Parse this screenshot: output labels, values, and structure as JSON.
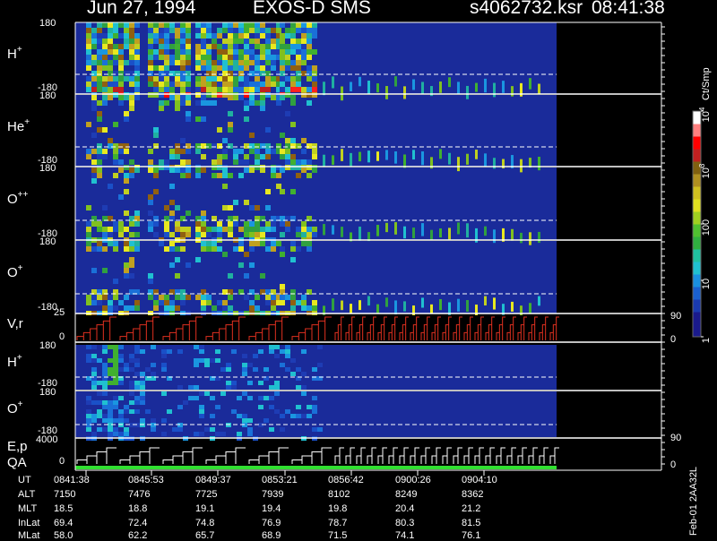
{
  "header": {
    "date": "Jun 27, 1994",
    "instrument": "EXOS-D SMS",
    "file": "s4062732.ksr",
    "time": "08:41:38"
  },
  "panels": [
    {
      "id": "H+",
      "label": "H",
      "sup": "+",
      "ytop": "180",
      "ybot": "-180"
    },
    {
      "id": "He+",
      "label": "He",
      "sup": "+",
      "ytop": "180",
      "ybot": "-180"
    },
    {
      "id": "O++",
      "label": "O",
      "sup": "++",
      "ytop": "180",
      "ybot": "-180"
    },
    {
      "id": "O+",
      "label": "O",
      "sup": "+",
      "ytop": "180",
      "ybot": "-180"
    }
  ],
  "vr_panel": {
    "label": "V,r",
    "ytop": "25",
    "ybot": "0",
    "right_top": "90",
    "right_bot": "0"
  },
  "lower_panels": [
    {
      "id": "H+2",
      "label": "H",
      "sup": "+",
      "ytop": "180",
      "ybot": "-180"
    },
    {
      "id": "O+2",
      "label": "O",
      "sup": "+",
      "ytop": "180",
      "ybot": "-180"
    }
  ],
  "ep_panel": {
    "label1": "E,p",
    "label2": "QA",
    "ytop": "4000",
    "ybot": "0",
    "right_top": "90",
    "right_bot": "0"
  },
  "colorbar": {
    "title": "Ct/Smp",
    "scale": "log",
    "range": [
      1,
      10000
    ],
    "ticks": [
      {
        "value": 10000,
        "label": "10",
        "sup": "4"
      },
      {
        "value": 1000,
        "label": "10",
        "sup": "3"
      },
      {
        "value": 100,
        "label": "100"
      },
      {
        "value": 10,
        "label": "10"
      },
      {
        "value": 1,
        "label": "1"
      }
    ],
    "colors": [
      "#1a1a8c",
      "#1a1a8c",
      "#1a3ab0",
      "#1a60d0",
      "#1a90e0",
      "#20c0d0",
      "#20c0a0",
      "#30b040",
      "#50c030",
      "#a0d020",
      "#e0e020",
      "#d0c020",
      "#b09020",
      "#806010",
      "#c02020",
      "#ff0000",
      "#ff8080",
      "#ffffff"
    ]
  },
  "footer_id": "Feb-01 2AA32L",
  "ephemeris": {
    "rows": [
      {
        "label": "UT",
        "values": [
          "0841:38",
          "0845:53",
          "0849:37",
          "0853:21",
          "0856:42",
          "0900:26",
          "0904:10"
        ]
      },
      {
        "label": "ALT",
        "values": [
          "7150",
          "7476",
          "7725",
          "7939",
          "8102",
          "8249",
          "8362"
        ]
      },
      {
        "label": "MLT",
        "values": [
          "18.5",
          "18.8",
          "19.1",
          "19.4",
          "19.8",
          "20.4",
          "21.2"
        ]
      },
      {
        "label": "InLat",
        "values": [
          "69.4",
          "72.4",
          "74.8",
          "76.9",
          "78.7",
          "80.3",
          "81.5"
        ]
      },
      {
        "label": "MLat",
        "values": [
          "58.0",
          "62.2",
          "65.7",
          "68.9",
          "71.5",
          "74.1",
          "76.1"
        ]
      }
    ]
  },
  "chart_data": {
    "type": "heatmap",
    "title": "Jun 27, 1994   EXOS-D SMS",
    "x_ticks_ut": [
      "0841:38",
      "0845:53",
      "0849:37",
      "0853:21",
      "0856:42",
      "0900:26",
      "0904:10"
    ],
    "panels": [
      "H+",
      "He+",
      "O++",
      "O+",
      "V,r",
      "H+",
      "O+",
      "E,p QA"
    ],
    "y_range_pitch": [
      -180,
      180
    ],
    "color_scale": {
      "type": "log",
      "min": 1,
      "max": 10000,
      "unit": "Ct/Smp"
    }
  }
}
